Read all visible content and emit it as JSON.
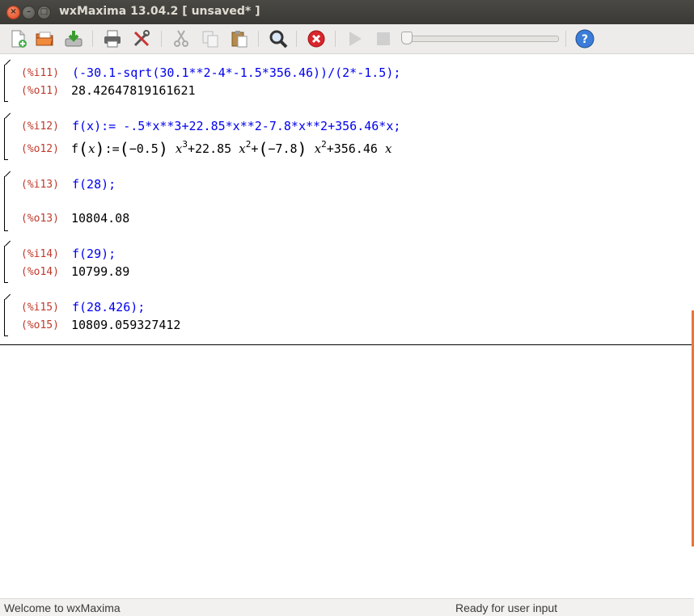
{
  "window": {
    "title": "wxMaxima 13.04.2 [ unsaved* ]"
  },
  "toolbar": {
    "icons": [
      "new-file-icon",
      "open-folder-icon",
      "save-icon",
      "print-icon",
      "preferences-icon",
      "cut-icon",
      "copy-icon",
      "paste-icon",
      "find-icon",
      "interrupt-icon",
      "play-icon",
      "stop-icon",
      "help-icon"
    ]
  },
  "cells": [
    {
      "in_label": "(%i11)",
      "input": "(-30.1-sqrt(30.1**2-4*-1.5*356.46))/(2*-1.5);",
      "out_label": "(%o11)",
      "output": "28.42647819161621"
    },
    {
      "in_label": "(%i12)",
      "input": "f(x):= -.5*x**3+22.85*x**2-7.8*x**2+356.46*x;",
      "out_label": "(%o12)",
      "math": {
        "f": "f",
        "x": "x",
        "def": ":=",
        "c1": "−0.5",
        "p1": "3",
        "plus1": "+22.85",
        "p2": "2",
        "plus2": "+",
        "c2": "−7.8",
        "p3": "2",
        "plus3": "+356.46"
      }
    },
    {
      "in_label": "(%i13)",
      "input": "f(28);",
      "out_label": "(%o13)",
      "output": "10804.08"
    },
    {
      "in_label": "(%i14)",
      "input": "f(29);",
      "out_label": "(%o14)",
      "output": "10799.89"
    },
    {
      "in_label": "(%i15)",
      "input": "f(28.426);",
      "out_label": "(%o15)",
      "output": "10809.059327412"
    }
  ],
  "status": {
    "left": "Welcome to wxMaxima",
    "right": "Ready for user input"
  },
  "colors": {
    "input": "#0000ee",
    "label": "#c0392b",
    "scroll_indicator": "#e8743c"
  }
}
